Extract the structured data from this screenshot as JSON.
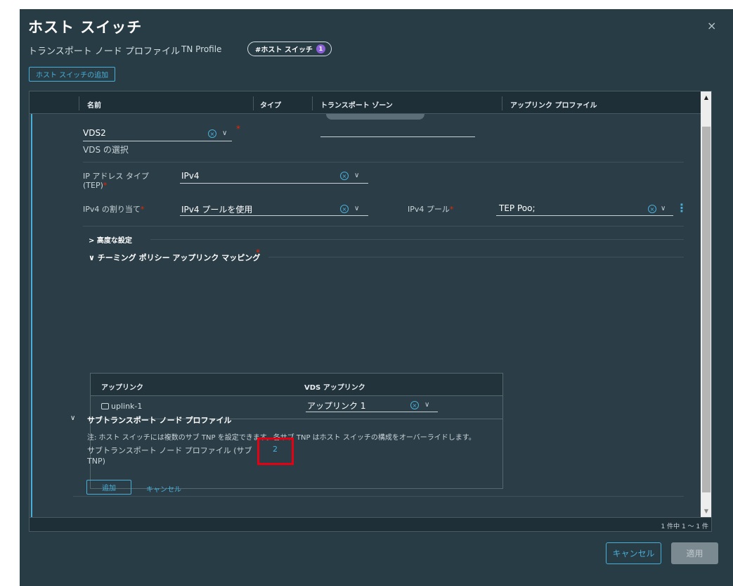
{
  "dialog": {
    "title": "ホスト スイッチ",
    "close_icon": "×",
    "subtitle": "トランスポート ノード プロファイル",
    "profile_name": "TN Profile",
    "chip_label": "#ホスト スイッチ",
    "chip_count": "1",
    "add_switch_label": "ホスト スイッチの追加"
  },
  "grid": {
    "columns": [
      "名前",
      "タイプ",
      "トランスポート ゾーン",
      "アップリンク プロファイル"
    ],
    "scroll_up": "▲",
    "scroll_down": "▼",
    "footer": "1 件中 1 ～ 1 件"
  },
  "form": {
    "vds_value": "VDS2",
    "vds_label": "VDS の選択",
    "ip_type_label": "IP アドレス タイプ",
    "ip_type_label2": "(TEP)",
    "ip_type_value": "IPv4",
    "ipv4_assign_label": "IPv4 の割り当て",
    "ipv4_assign_value": "IPv4 プールを使用",
    "ipv4_pool_label": "IPv4 プール",
    "ipv4_pool_value": "TEP Poo;",
    "required_mark": "*",
    "clear_icon": "×",
    "chevron_down": "∨",
    "more_icon": "⋮",
    "advanced_label": "> 高度な設定",
    "teaming_label": "∨ チーミング ポリシー アップリンク マッピング"
  },
  "uplink_table": {
    "headers": [
      "アップリンク",
      "VDS アップリンク"
    ],
    "rows": [
      {
        "uplink": "uplink-1",
        "vds_uplink": "アップリンク 1"
      }
    ]
  },
  "sub_tnp": {
    "chevron": "∨",
    "title": "サブトランスポート ノード プロファイル",
    "note": "注: ホスト スイッチには複数のサブ TNP を設定できます。各サブ TNP はホスト スイッチの構成をオーバーライドします。",
    "count_label": "サブトランスポート ノード プロファイル (サブ",
    "count_label2": "TNP)",
    "count_value": "2",
    "add_label": "追加",
    "cancel_label": "キャンセル"
  },
  "footer_buttons": {
    "cancel": "キャンセル",
    "apply": "適用"
  },
  "colors": {
    "accent": "#49afd9",
    "background": "#283c46",
    "required": "#e62700",
    "highlight": "#e60012"
  }
}
